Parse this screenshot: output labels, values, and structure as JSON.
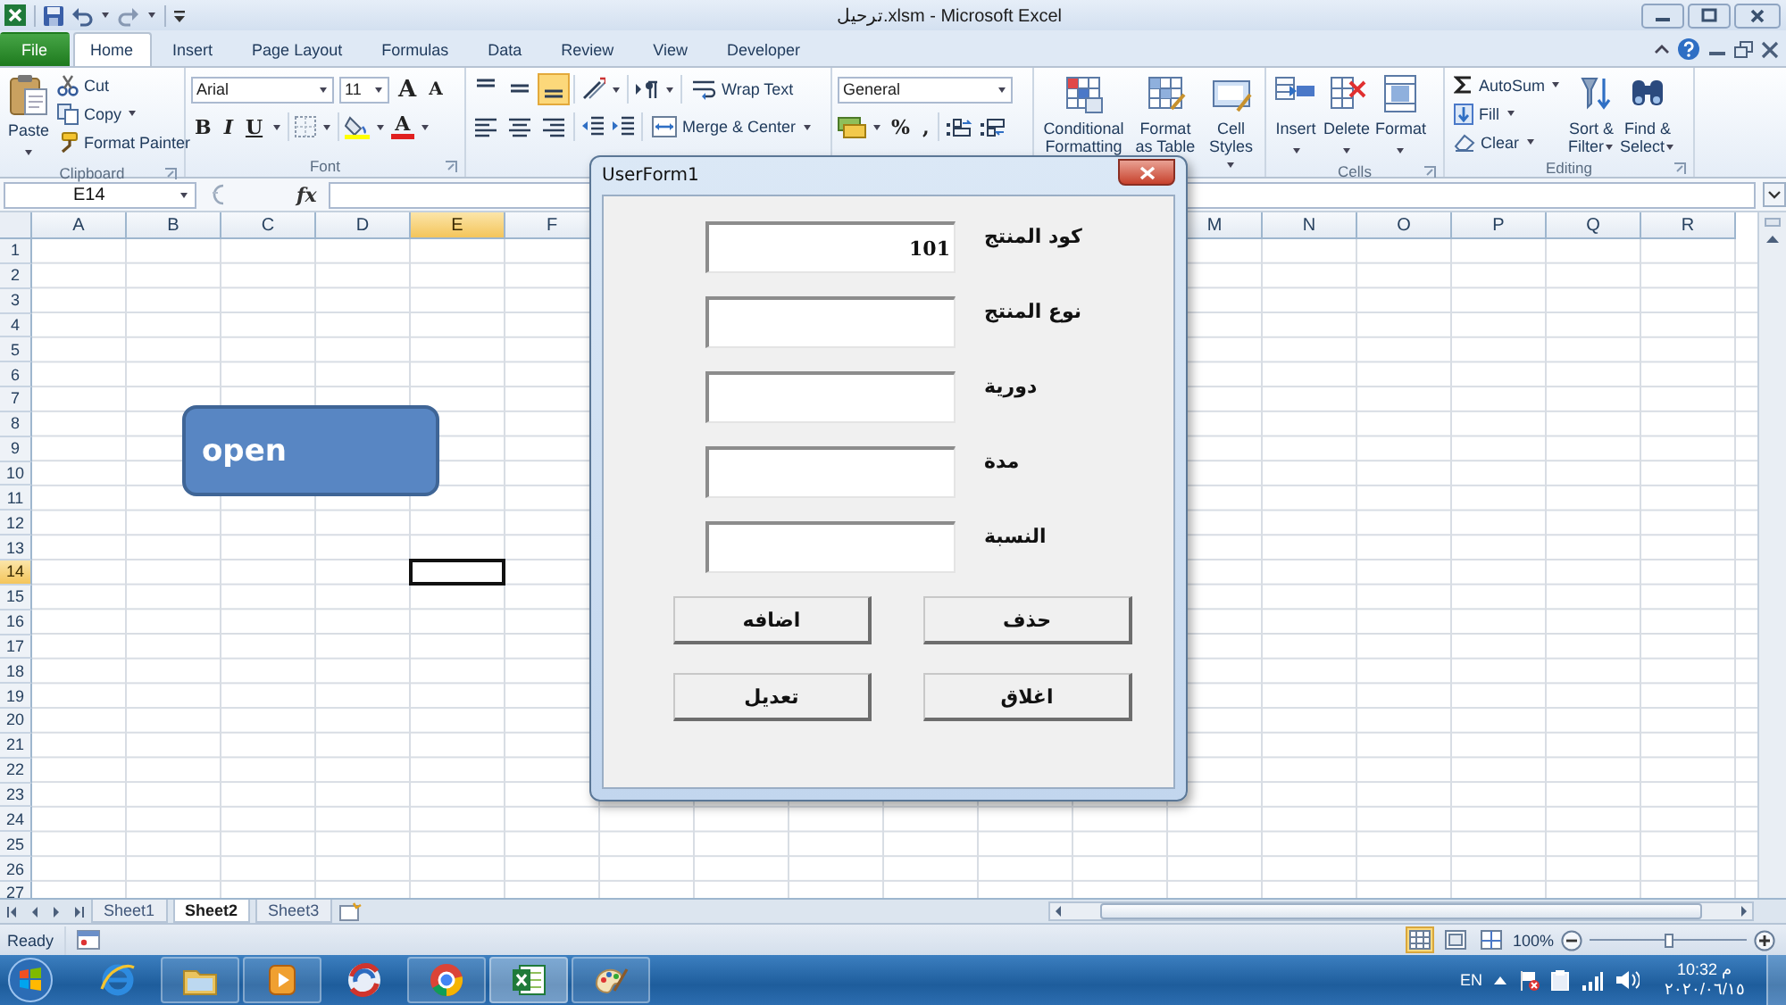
{
  "window": {
    "title": "ترحيل.xlsm  -  Microsoft Excel"
  },
  "ribbon_tabs": [
    {
      "label": "File",
      "kind": "file",
      "selected": false
    },
    {
      "label": "Home",
      "kind": "tab",
      "selected": true
    },
    {
      "label": "Insert",
      "kind": "tab",
      "selected": false
    },
    {
      "label": "Page Layout",
      "kind": "tab",
      "selected": false
    },
    {
      "label": "Formulas",
      "kind": "tab",
      "selected": false
    },
    {
      "label": "Data",
      "kind": "tab",
      "selected": false
    },
    {
      "label": "Review",
      "kind": "tab",
      "selected": false
    },
    {
      "label": "View",
      "kind": "tab",
      "selected": false
    },
    {
      "label": "Developer",
      "kind": "tab",
      "selected": false
    }
  ],
  "clipboard": {
    "label": "Clipboard",
    "paste": "Paste",
    "cut": "Cut",
    "copy": "Copy",
    "format_painter": "Format Painter"
  },
  "font": {
    "label": "Font",
    "font_name": "Arial",
    "font_size": "11",
    "grow_font": "A",
    "shrink_font": "A",
    "bold": "B",
    "italic": "I",
    "underline": "U",
    "font_color": "A"
  },
  "alignment": {
    "vertical_align": [
      {
        "selected": false
      },
      {
        "selected": false
      },
      {
        "selected": true
      }
    ],
    "wrap_text": "Wrap Text",
    "merge_center": "Merge & Center"
  },
  "number": {
    "format": "General",
    "percent": "%",
    "comma": ","
  },
  "styles": {
    "buttons": [
      {
        "label": "Conditional\nFormatting",
        "kind": "conditional"
      },
      {
        "label": "Format\nas Table",
        "kind": "table"
      },
      {
        "label": "Cell\nStyles",
        "kind": "cellstyles"
      }
    ]
  },
  "cells": {
    "label": "Cells",
    "buttons": [
      {
        "label": "Insert",
        "kind": "insert"
      },
      {
        "label": "Delete",
        "kind": "delete"
      },
      {
        "label": "Format",
        "kind": "format"
      }
    ]
  },
  "editing": {
    "label": "Editing",
    "autosum": "AutoSum",
    "fill": "Fill",
    "clear": "Clear",
    "sort_filter": "Sort &\nFilter",
    "find_select": "Find &\nSelect"
  },
  "formula_bar": {
    "name_box": "E14",
    "function_label": "fx"
  },
  "sheet": {
    "columns_left": [
      {
        "label": "A",
        "selected": false
      },
      {
        "label": "B",
        "selected": false
      },
      {
        "label": "C",
        "selected": false
      },
      {
        "label": "D",
        "selected": false
      },
      {
        "label": "E",
        "selected": true
      },
      {
        "label": "F",
        "selected": false
      }
    ],
    "columns_right": [
      {
        "label": "M",
        "selected": false
      },
      {
        "label": "N",
        "selected": false
      },
      {
        "label": "O",
        "selected": false
      },
      {
        "label": "P",
        "selected": false
      },
      {
        "label": "Q",
        "selected": false
      },
      {
        "label": "R",
        "selected": false
      }
    ],
    "rows": [
      {
        "label": "1",
        "selected": false
      },
      {
        "label": "2",
        "selected": false
      },
      {
        "label": "3",
        "selected": false
      },
      {
        "label": "4",
        "selected": false
      },
      {
        "label": "5",
        "selected": false
      },
      {
        "label": "6",
        "selected": false
      },
      {
        "label": "7",
        "selected": false
      },
      {
        "label": "8",
        "selected": false
      },
      {
        "label": "9",
        "selected": false
      },
      {
        "label": "10",
        "selected": false
      },
      {
        "label": "11",
        "selected": false
      },
      {
        "label": "12",
        "selected": false
      },
      {
        "label": "13",
        "selected": false
      },
      {
        "label": "14",
        "selected": true
      },
      {
        "label": "15",
        "selected": false
      },
      {
        "label": "16",
        "selected": false
      },
      {
        "label": "17",
        "selected": false
      },
      {
        "label": "18",
        "selected": false
      },
      {
        "label": "19",
        "selected": false
      },
      {
        "label": "20",
        "selected": false
      },
      {
        "label": "21",
        "selected": false
      },
      {
        "label": "22",
        "selected": false
      },
      {
        "label": "23",
        "selected": false
      },
      {
        "label": "24",
        "selected": false
      },
      {
        "label": "25",
        "selected": false
      },
      {
        "label": "26",
        "selected": false
      },
      {
        "label": "27",
        "selected": false
      }
    ],
    "shapes": [
      {
        "text": "open"
      }
    ]
  },
  "sheet_tabs": [
    {
      "label": "Sheet1",
      "selected": false
    },
    {
      "label": "Sheet2",
      "selected": true
    },
    {
      "label": "Sheet3",
      "selected": false
    }
  ],
  "status_bar": {
    "status": "Ready",
    "views": [
      {
        "kind": "normal",
        "selected": true
      },
      {
        "kind": "layout",
        "selected": false
      },
      {
        "kind": "preview",
        "selected": false
      }
    ],
    "zoom": "100%",
    "zoom_slider": {
      "level": 0.5
    }
  },
  "userform": {
    "title": "UserForm1",
    "fields": [
      {
        "label": "كود المنتج",
        "value": "101"
      },
      {
        "label": "نوع المنتج"
      },
      {
        "label": "دورية"
      },
      {
        "label": "مدة"
      },
      {
        "label": "النسبة"
      }
    ],
    "buttons": [
      {
        "label": "اضافه"
      },
      {
        "label": "حذف"
      },
      {
        "label": "تعديل"
      },
      {
        "label": "اغلاق"
      }
    ]
  },
  "taskbar": {
    "apps": [
      {
        "kind": "ie",
        "running": false,
        "selected": false
      },
      {
        "kind": "folder",
        "running": true,
        "selected": false
      },
      {
        "kind": "media",
        "running": true,
        "selected": false
      },
      {
        "kind": "swirl",
        "running": false,
        "selected": false
      },
      {
        "kind": "chrome",
        "running": true,
        "selected": false
      },
      {
        "kind": "excel",
        "running": true,
        "selected": true
      },
      {
        "kind": "paint",
        "running": true,
        "selected": false
      }
    ],
    "language": "EN",
    "time": "10:32 م",
    "date": "٢٠٢٠/٠٦/١٥"
  }
}
